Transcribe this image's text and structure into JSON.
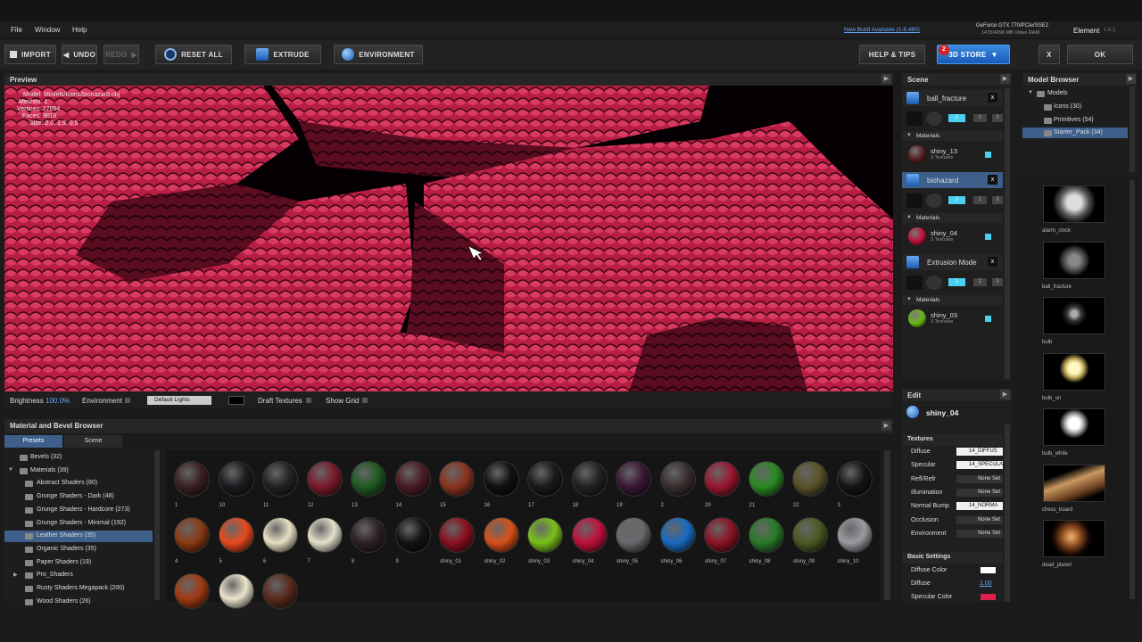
{
  "menu": {
    "file": "File",
    "window": "Window",
    "help": "Help"
  },
  "status": {
    "new_build": "New Build Available (1.6.480)",
    "gpu": "GeForce GTX 770/PCIe/SSE2",
    "vram": "1470/4096 MB Video RAM",
    "app": "Element",
    "version": "1.6.1"
  },
  "toolbar": {
    "import": "IMPORT",
    "undo": "UNDO",
    "redo": "REDO",
    "reset_all": "RESET ALL",
    "extrude": "EXTRUDE",
    "environment": "ENVIRONMENT",
    "help_tips": "HELP & TIPS",
    "store_badge": "2",
    "store": "3D STORE",
    "close": "X",
    "ok": "OK"
  },
  "preview": {
    "title": "Preview",
    "model": "Model: Models/Icons/biohazard.obj",
    "meshes": "Meshes: 1",
    "vertices": "Vertices: 27054",
    "faces": "Faces: 9018",
    "size": "Size: 2.0, 1.9, 0.5"
  },
  "controls": {
    "brightness": "Brightness",
    "brightness_value": "100.0%",
    "environment": "Environment",
    "lights": "Default Lights",
    "draft": "Draft Textures",
    "grid": "Show Grid"
  },
  "browser": {
    "title": "Material and Bevel Browser",
    "tab_presets": "Presets",
    "tab_scene": "Scene",
    "tree": [
      {
        "label": "Bevels (32)",
        "level": 1
      },
      {
        "label": "Materials (39)",
        "level": 1
      },
      {
        "label": "Abstract Shaders (80)",
        "level": 2
      },
      {
        "label": "Grunge Shaders - Dark (48)",
        "level": 2
      },
      {
        "label": "Grunge Shaders - Hardcore (273)",
        "level": 2
      },
      {
        "label": "Grunge Shaders - Minimal (192)",
        "level": 2
      },
      {
        "label": "Leather Shaders (35)",
        "level": 2,
        "selected": true
      },
      {
        "label": "Organic Shaders (35)",
        "level": 2
      },
      {
        "label": "Paper Shaders (19)",
        "level": 2
      },
      {
        "label": "Pro_Shaders",
        "level": 2
      },
      {
        "label": "Rusty Shaders Megapack (200)",
        "level": 2
      },
      {
        "label": "Wood Shaders (26)",
        "level": 2
      }
    ],
    "row1": [
      {
        "l": "1",
        "c": "#3a2020"
      },
      {
        "l": "10",
        "c": "#1c1c20"
      },
      {
        "l": "11",
        "c": "#232325"
      },
      {
        "l": "12",
        "c": "#7a1a2c"
      },
      {
        "l": "13",
        "c": "#1f5a22"
      },
      {
        "l": "14",
        "c": "#4a1c24"
      },
      {
        "l": "15",
        "c": "#8a3420"
      },
      {
        "l": "16",
        "c": "#101012"
      },
      {
        "l": "17",
        "c": "#1a1a1a"
      },
      {
        "l": "18",
        "c": "#222"
      },
      {
        "l": "19",
        "c": "#3a1838"
      },
      {
        "l": "2",
        "c": "#3a2e2e"
      },
      {
        "l": "20",
        "c": "#9a1630"
      },
      {
        "l": "21",
        "c": "#2a8a24"
      },
      {
        "l": "22",
        "c": "#5a5228"
      },
      {
        "l": "3",
        "c": "#151517"
      }
    ],
    "row2": [
      {
        "l": "4",
        "c": "#8a3a14"
      },
      {
        "l": "5",
        "c": "#e84a20"
      },
      {
        "l": "6",
        "c": "#e8e0c4"
      },
      {
        "l": "7",
        "c": "#e4e0cc"
      },
      {
        "l": "8",
        "c": "#2e2226"
      },
      {
        "l": "9",
        "c": "#141416"
      },
      {
        "l": "shiny_01",
        "c": "#8a1020"
      },
      {
        "l": "shiny_02",
        "c": "#d8501a"
      },
      {
        "l": "shiny_03",
        "c": "#7ac01a"
      },
      {
        "l": "shiny_04",
        "c": "#c0103a"
      },
      {
        "l": "shiny_05",
        "c": "#6a6a6e"
      },
      {
        "l": "shiny_06",
        "c": "#1a6ac0"
      },
      {
        "l": "shiny_07",
        "c": "#8a1426"
      },
      {
        "l": "shiny_08",
        "c": "#2a7a2a"
      },
      {
        "l": "shiny_09",
        "c": "#4a5a24"
      },
      {
        "l": "shiny_10",
        "c": "#9a9aa0"
      }
    ],
    "row3": [
      {
        "c": "#a03a14"
      },
      {
        "c": "#ebe4cc"
      },
      {
        "c": "#5a2a1e"
      }
    ]
  },
  "scene": {
    "title": "Scene",
    "objects": [
      {
        "name": "ball_fracture",
        "mat": "shiny_13",
        "tex": "3 Textures",
        "color": "#5a1e1e"
      },
      {
        "name": "biohazard",
        "mat": "shiny_04",
        "tex": "3 Textures",
        "color": "#c0103a"
      },
      {
        "name": "Extrusion Mode",
        "mat": "shiny_03",
        "tex": "3 Textures",
        "color": "#6ab818"
      }
    ],
    "materials_label": "Materials",
    "close": "x",
    "l1": "1",
    "l2": "2",
    "l3": "3"
  },
  "edit": {
    "title": "Edit",
    "material": "shiny_04",
    "textures": "Textures",
    "rows": [
      {
        "k": "Diffuse",
        "v": "14_DIFFUS"
      },
      {
        "k": "Specular",
        "v": "14_SPECULA"
      },
      {
        "k": "Refl/Refr",
        "v": "None Set"
      },
      {
        "k": "Illumination",
        "v": "None Set"
      },
      {
        "k": "Normal Bump",
        "v": "14_NORMA"
      },
      {
        "k": "Occlusion",
        "v": "None Set"
      },
      {
        "k": "Environment",
        "v": "None Set"
      }
    ],
    "basic": "Basic Settings",
    "diffuse_color": "Diffuse Color",
    "diffuse": "Diffuse",
    "diffuse_value": "1.00",
    "specular_color": "Specular Color"
  },
  "model_browser": {
    "title": "Model Browser",
    "tree": [
      {
        "label": "Models",
        "level": 1
      },
      {
        "label": "Icons (30)",
        "level": 2
      },
      {
        "label": "Primitives (54)",
        "level": 2
      },
      {
        "label": "Starter_Pack (34)",
        "level": 2,
        "selected": true
      }
    ],
    "items": [
      "alarm_clock",
      "ball_fracture",
      "bulb",
      "bulb_on",
      "bulb_white",
      "chess_board",
      "dead_planet"
    ]
  },
  "colors": {
    "accent": "#2f6fc0",
    "selected": "#3d5f8a",
    "pink": "#c8284e"
  }
}
